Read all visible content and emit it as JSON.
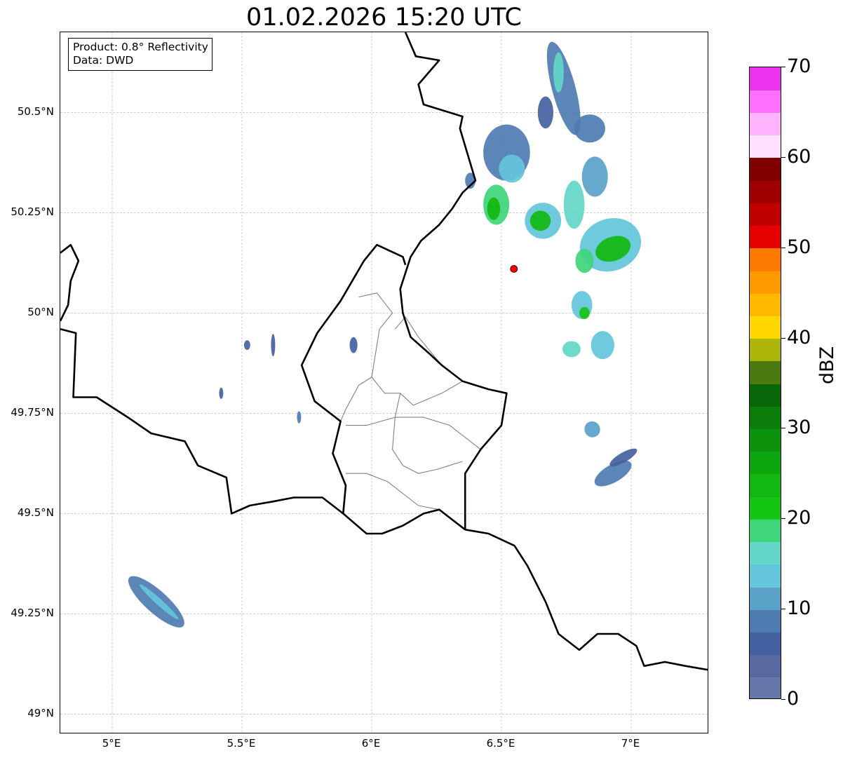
{
  "title": "01.02.2026 15:20 UTC",
  "info_box": {
    "product": "Product: 0.8° Reflectivity",
    "data": "Data: DWD"
  },
  "map": {
    "lon_range": [
      4.8,
      7.3
    ],
    "lat_range": [
      48.95,
      50.7
    ],
    "lat_ticks": [
      {
        "value": 49.0,
        "label": "49°N"
      },
      {
        "value": 49.25,
        "label": "49.25°N"
      },
      {
        "value": 49.5,
        "label": "49.5°N"
      },
      {
        "value": 49.75,
        "label": "49.75°N"
      },
      {
        "value": 50.0,
        "label": "50°N"
      },
      {
        "value": 50.25,
        "label": "50.25°N"
      },
      {
        "value": 50.5,
        "label": "50.5°N"
      }
    ],
    "lon_ticks": [
      {
        "value": 5.0,
        "label": "5°E"
      },
      {
        "value": 5.5,
        "label": "5.5°E"
      },
      {
        "value": 6.0,
        "label": "6°E"
      },
      {
        "value": 6.5,
        "label": "6.5°E"
      },
      {
        "value": 7.0,
        "label": "7°E"
      }
    ],
    "gridlines": true,
    "radar_site": {
      "lon": 6.548,
      "lat": 50.11,
      "color": "#ff0000"
    },
    "border_color": "#000000",
    "internal_border_color": "#808080",
    "national_borders": [
      [
        [
          6.13,
          50.7
        ],
        [
          6.17,
          50.64
        ],
        [
          6.26,
          50.63
        ],
        [
          6.18,
          50.57
        ],
        [
          6.2,
          50.52
        ],
        [
          6.35,
          50.49
        ],
        [
          6.34,
          50.46
        ],
        [
          6.4,
          50.33
        ],
        [
          6.35,
          50.3
        ],
        [
          6.31,
          50.26
        ],
        [
          6.26,
          50.22
        ],
        [
          6.19,
          50.18
        ],
        [
          6.15,
          50.14
        ],
        [
          6.11,
          50.06
        ],
        [
          6.12,
          50.0
        ],
        [
          6.15,
          49.94
        ],
        [
          6.22,
          49.9
        ],
        [
          6.27,
          49.87
        ],
        [
          6.35,
          49.83
        ],
        [
          6.45,
          49.81
        ],
        [
          6.52,
          49.8
        ],
        [
          6.5,
          49.72
        ],
        [
          6.42,
          49.66
        ],
        [
          6.36,
          49.6
        ],
        [
          6.36,
          49.46
        ]
      ],
      [
        [
          6.36,
          49.46
        ],
        [
          6.45,
          49.45
        ],
        [
          6.55,
          49.42
        ],
        [
          6.6,
          49.37
        ],
        [
          6.67,
          49.28
        ],
        [
          6.72,
          49.2
        ],
        [
          6.8,
          49.16
        ],
        [
          6.87,
          49.2
        ],
        [
          6.95,
          49.2
        ],
        [
          7.02,
          49.17
        ],
        [
          7.05,
          49.12
        ],
        [
          7.13,
          49.13
        ],
        [
          7.21,
          49.12
        ],
        [
          7.3,
          49.11
        ]
      ],
      [
        [
          5.89,
          49.5
        ],
        [
          5.98,
          49.45
        ],
        [
          6.04,
          49.45
        ],
        [
          6.12,
          49.47
        ],
        [
          6.2,
          49.5
        ],
        [
          6.26,
          49.51
        ],
        [
          6.36,
          49.46
        ]
      ],
      [
        [
          4.8,
          49.96
        ],
        [
          4.86,
          49.95
        ],
        [
          4.85,
          49.79
        ],
        [
          4.94,
          49.79
        ],
        [
          5.06,
          49.74
        ],
        [
          5.15,
          49.7
        ],
        [
          5.28,
          49.68
        ],
        [
          5.33,
          49.62
        ],
        [
          5.44,
          49.59
        ],
        [
          5.46,
          49.5
        ],
        [
          5.53,
          49.52
        ],
        [
          5.62,
          49.53
        ],
        [
          5.7,
          49.54
        ],
        [
          5.81,
          49.54
        ],
        [
          5.89,
          49.5
        ]
      ],
      [
        [
          5.89,
          49.5
        ],
        [
          5.9,
          49.57
        ],
        [
          5.85,
          49.65
        ],
        [
          5.88,
          49.73
        ],
        [
          5.78,
          49.78
        ],
        [
          5.73,
          49.87
        ],
        [
          5.79,
          49.95
        ],
        [
          5.88,
          50.03
        ],
        [
          5.97,
          50.13
        ],
        [
          6.02,
          50.17
        ],
        [
          6.12,
          50.14
        ],
        [
          6.13,
          50.12
        ]
      ],
      [
        [
          4.8,
          50.15
        ],
        [
          4.84,
          50.17
        ],
        [
          4.87,
          50.13
        ],
        [
          4.84,
          50.08
        ],
        [
          4.83,
          50.02
        ],
        [
          4.8,
          49.98
        ]
      ]
    ],
    "internal_borders": [
      [
        [
          5.95,
          50.04
        ],
        [
          6.02,
          50.05
        ],
        [
          6.08,
          50.0
        ],
        [
          6.03,
          49.96
        ],
        [
          6.0,
          49.84
        ],
        [
          5.95,
          49.82
        ],
        [
          5.9,
          49.76
        ],
        [
          5.88,
          49.73
        ]
      ],
      [
        [
          6.0,
          49.84
        ],
        [
          6.05,
          49.8
        ],
        [
          6.11,
          49.8
        ],
        [
          6.16,
          49.77
        ],
        [
          6.27,
          49.8
        ],
        [
          6.35,
          49.83
        ]
      ],
      [
        [
          6.11,
          49.8
        ],
        [
          6.09,
          49.74
        ],
        [
          6.08,
          49.66
        ],
        [
          6.12,
          49.62
        ],
        [
          6.18,
          49.6
        ],
        [
          6.25,
          49.61
        ],
        [
          6.35,
          49.63
        ]
      ],
      [
        [
          5.9,
          49.72
        ],
        [
          5.98,
          49.72
        ],
        [
          6.09,
          49.74
        ],
        [
          6.2,
          49.74
        ],
        [
          6.3,
          49.72
        ],
        [
          6.42,
          49.66
        ]
      ],
      [
        [
          5.9,
          49.6
        ],
        [
          5.98,
          49.6
        ],
        [
          6.06,
          49.58
        ],
        [
          6.18,
          49.52
        ],
        [
          6.26,
          49.51
        ]
      ],
      [
        [
          6.09,
          49.96
        ],
        [
          6.13,
          49.99
        ],
        [
          6.18,
          49.94
        ],
        [
          6.27,
          49.87
        ]
      ]
    ]
  },
  "colorbar": {
    "label": "dBZ",
    "min": 0,
    "max": 70,
    "step": 2.5,
    "ticks": [
      0,
      10,
      20,
      30,
      40,
      50,
      60,
      70
    ],
    "tick_labels": [
      "0",
      "10",
      "20",
      "30",
      "40",
      "50",
      "60",
      "70"
    ],
    "colors": [
      "#6577a8",
      "#5769a0",
      "#4560a0",
      "#4e7cb1",
      "#5aa2c8",
      "#64c6da",
      "#63d7c7",
      "#3fd57a",
      "#14c614",
      "#11b811",
      "#0ea60e",
      "#0c920c",
      "#0a7d0a",
      "#086508",
      "#4a7a10",
      "#adb50a",
      "#ffd700",
      "#ffb700",
      "#ff9900",
      "#ff7a00",
      "#e60000",
      "#c00000",
      "#a00000",
      "#800000",
      "#ffe0ff",
      "#ffb3ff",
      "#ff70ff",
      "#ee33ee"
    ]
  },
  "echoes": [
    {
      "lon": 6.74,
      "lat": 50.56,
      "rx": 0.045,
      "ry": 0.12,
      "rot": -15,
      "dbz": 8
    },
    {
      "lon": 6.72,
      "lat": 50.6,
      "rx": 0.02,
      "ry": 0.05,
      "rot": 0,
      "dbz": 16
    },
    {
      "lon": 6.67,
      "lat": 50.5,
      "rx": 0.03,
      "ry": 0.04,
      "rot": 0,
      "dbz": 5
    },
    {
      "lon": 6.84,
      "lat": 50.46,
      "rx": 0.06,
      "ry": 0.035,
      "rot": 0,
      "dbz": 8
    },
    {
      "lon": 6.52,
      "lat": 50.4,
      "rx": 0.09,
      "ry": 0.07,
      "rot": 0,
      "dbz": 8
    },
    {
      "lon": 6.54,
      "lat": 50.36,
      "rx": 0.05,
      "ry": 0.035,
      "rot": 0,
      "dbz": 13
    },
    {
      "lon": 6.48,
      "lat": 50.27,
      "rx": 0.05,
      "ry": 0.05,
      "rot": 0,
      "dbz": 18
    },
    {
      "lon": 6.47,
      "lat": 50.26,
      "rx": 0.025,
      "ry": 0.028,
      "rot": 0,
      "dbz": 24
    },
    {
      "lon": 6.38,
      "lat": 50.33,
      "rx": 0.02,
      "ry": 0.02,
      "rot": 0,
      "dbz": 8
    },
    {
      "lon": 6.66,
      "lat": 50.23,
      "rx": 0.07,
      "ry": 0.045,
      "rot": 0,
      "dbz": 13
    },
    {
      "lon": 6.65,
      "lat": 50.23,
      "rx": 0.04,
      "ry": 0.025,
      "rot": 0,
      "dbz": 24
    },
    {
      "lon": 6.78,
      "lat": 50.27,
      "rx": 0.04,
      "ry": 0.06,
      "rot": 0,
      "dbz": 16
    },
    {
      "lon": 6.86,
      "lat": 50.34,
      "rx": 0.05,
      "ry": 0.05,
      "rot": 0,
      "dbz": 12
    },
    {
      "lon": 6.92,
      "lat": 50.17,
      "rx": 0.12,
      "ry": 0.065,
      "rot": -20,
      "dbz": 14
    },
    {
      "lon": 6.93,
      "lat": 50.16,
      "rx": 0.07,
      "ry": 0.03,
      "rot": -20,
      "dbz": 24
    },
    {
      "lon": 6.82,
      "lat": 50.13,
      "rx": 0.035,
      "ry": 0.03,
      "rot": 0,
      "dbz": 18
    },
    {
      "lon": 6.81,
      "lat": 50.02,
      "rx": 0.04,
      "ry": 0.035,
      "rot": 0,
      "dbz": 13
    },
    {
      "lon": 6.82,
      "lat": 50.0,
      "rx": 0.02,
      "ry": 0.015,
      "rot": 0,
      "dbz": 22
    },
    {
      "lon": 6.89,
      "lat": 49.92,
      "rx": 0.045,
      "ry": 0.035,
      "rot": 0,
      "dbz": 14
    },
    {
      "lon": 6.77,
      "lat": 49.91,
      "rx": 0.035,
      "ry": 0.02,
      "rot": 0,
      "dbz": 16
    },
    {
      "lon": 6.85,
      "lat": 49.71,
      "rx": 0.03,
      "ry": 0.02,
      "rot": -30,
      "dbz": 10
    },
    {
      "lon": 6.93,
      "lat": 49.6,
      "rx": 0.08,
      "ry": 0.022,
      "rot": -30,
      "dbz": 8
    },
    {
      "lon": 6.97,
      "lat": 49.64,
      "rx": 0.06,
      "ry": 0.012,
      "rot": -30,
      "dbz": 6
    },
    {
      "lon": 5.17,
      "lat": 49.28,
      "rx": 0.14,
      "ry": 0.028,
      "rot": 42,
      "dbz": 8
    },
    {
      "lon": 5.18,
      "lat": 49.28,
      "rx": 0.1,
      "ry": 0.008,
      "rot": 42,
      "dbz": 14
    },
    {
      "lon": 5.52,
      "lat": 49.92,
      "rx": 0.012,
      "ry": 0.012,
      "rot": 0,
      "dbz": 5
    },
    {
      "lon": 5.62,
      "lat": 49.92,
      "rx": 0.008,
      "ry": 0.028,
      "rot": 0,
      "dbz": 5
    },
    {
      "lon": 5.72,
      "lat": 49.74,
      "rx": 0.008,
      "ry": 0.015,
      "rot": 0,
      "dbz": 8
    },
    {
      "lon": 5.93,
      "lat": 49.92,
      "rx": 0.015,
      "ry": 0.02,
      "rot": 0,
      "dbz": 5
    },
    {
      "lon": 5.42,
      "lat": 49.8,
      "rx": 0.008,
      "ry": 0.014,
      "rot": 0,
      "dbz": 5
    }
  ]
}
